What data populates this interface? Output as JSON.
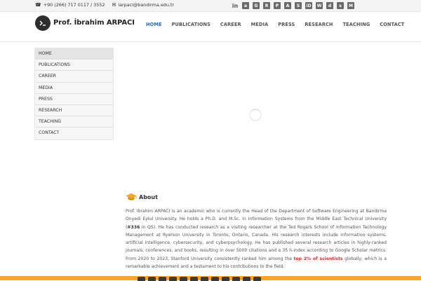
{
  "topbar": {
    "phone": "+90 (266) 717 0117 / 3552",
    "email": "iarpaci@bandirma.edu.tr",
    "social": [
      {
        "icon": "linkedin-icon",
        "label": "in"
      },
      {
        "icon": "academia-icon",
        "label": "a"
      },
      {
        "icon": "scholar-icon",
        "label": "G"
      },
      {
        "icon": "researchgate-icon",
        "label": "R"
      },
      {
        "icon": "publons-icon",
        "label": "P"
      },
      {
        "icon": "acm-icon",
        "label": "A"
      },
      {
        "icon": "scopus-icon",
        "label": "S"
      },
      {
        "icon": "orcid-icon",
        "label": "iD"
      },
      {
        "icon": "wos-icon",
        "label": "W"
      },
      {
        "icon": "dblp-icon",
        "label": "d"
      },
      {
        "icon": "sciprofiles-icon",
        "label": "s"
      },
      {
        "icon": "medium-icon",
        "label": "M"
      }
    ]
  },
  "header": {
    "brand": "Prof. İbrahim ARPACI",
    "nav": [
      "HOME",
      "PUBLICATIONS",
      "CAREER",
      "MEDIA",
      "PRESS",
      "RESEARCH",
      "TEACHING",
      "CONTACT"
    ],
    "active_index": 0
  },
  "sidebar": {
    "items": [
      "HOME",
      "PUBLICATIONS",
      "CAREER",
      "MEDIA",
      "PRESS",
      "RESEARCH",
      "TEACHING",
      "CONTACT"
    ]
  },
  "about": {
    "title": "About",
    "p1": "Prof. Ibrahim ARPACI is an academic who is currently the Head of the Department of Software Engineering at Bandirma Onyedi Eylul University. He holds a Ph.D. and M.Sc. in Information Systems from the Middle East Technical University (",
    "rank": "#336",
    "p2": " in QS). He has conducted research as a visiting researcher at the Ted Rogers School of Information Technology Management at Ryerson University in Toronto, Ontario, Canada. His research interests include information systems, artificial intelligence, cybersecurity, and cyberpsychology. He has published several research articles in highly-ranked journals, conferences, and books, resulting in over 5000 citations and a 35 h-index according to Google Scholar metrics. From 2020 to 2023, Stanford University consistently ranked him among the ",
    "highlight": "top 2% of scientists",
    "p3": " globally, which is a remarkable achievement and a testament to his contributions to the field."
  },
  "colors": {
    "accent": "#2f6ea5",
    "highlight": "#d32b2b",
    "footer": "#f6a623"
  }
}
